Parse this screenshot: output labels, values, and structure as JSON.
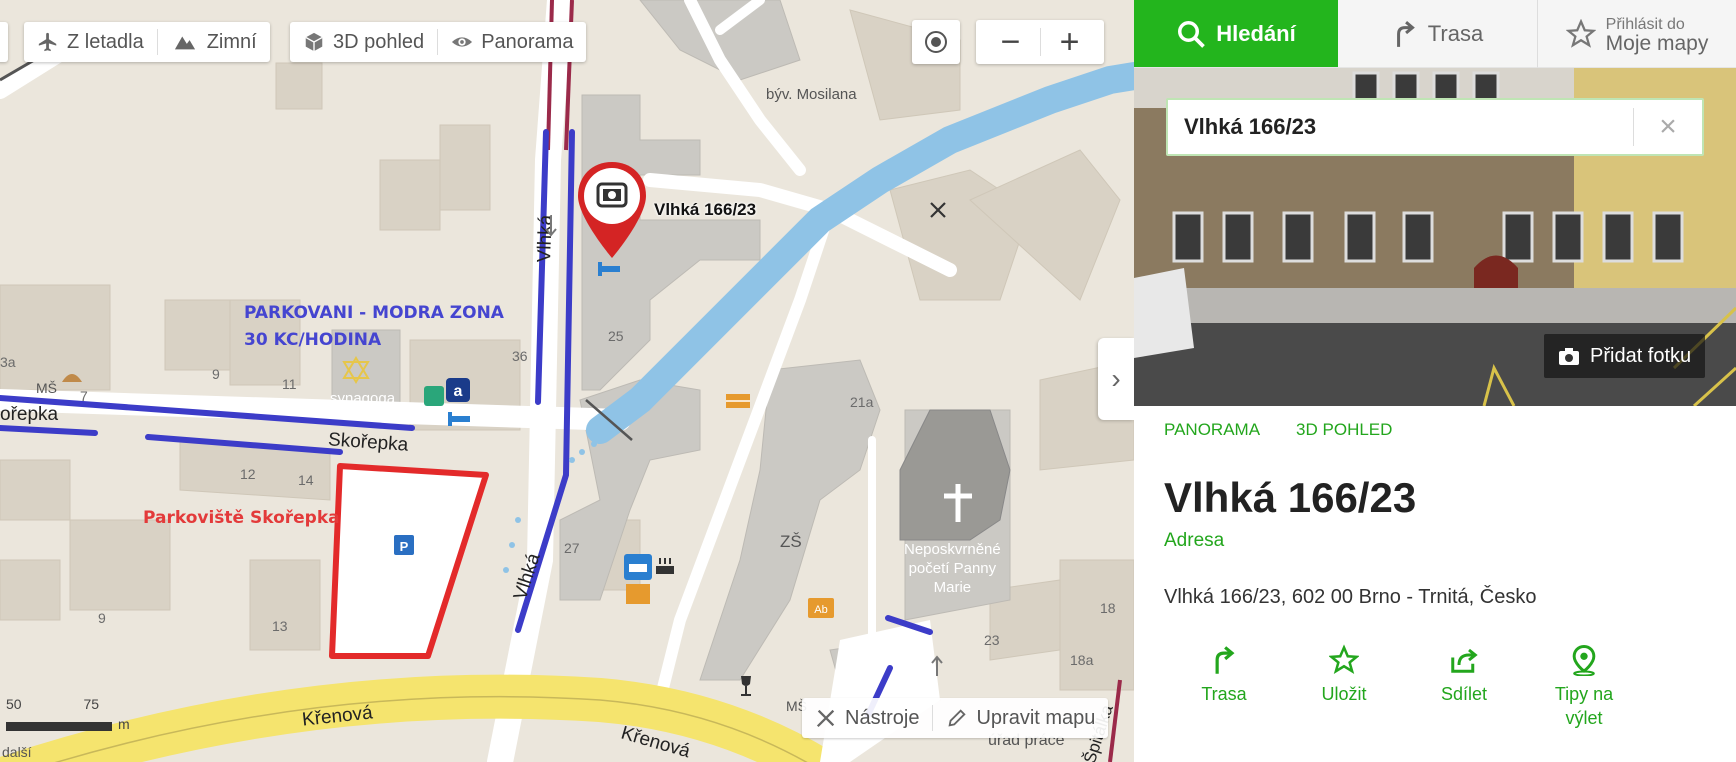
{
  "map": {
    "toolbar": {
      "aerial": "Z letadla",
      "winter": "Zimní",
      "view3d": "3D pohled",
      "panorama": "Panorama"
    },
    "zoom_out": "−",
    "zoom_in": "+",
    "bottom": {
      "tools": "Nástroje",
      "edit": "Upravit mapu"
    },
    "scale": {
      "a": "50",
      "b": "75",
      "unit": "m"
    },
    "more": "další",
    "streets": {
      "skorepka": "Skořepka",
      "skorepka_left": "ořepka",
      "vlhka_top": "Vlhká",
      "vlhka_bottom": "Vlhká",
      "krenova_left": "Křenová",
      "krenova_right": "Křenová",
      "spitalka": "Špitálka"
    },
    "places": {
      "mosilana": "býv. Mosilana",
      "synagoga": "synagoga",
      "church": "Neposkvrněné\npočetí Panny\nMarie",
      "zs": "ZŠ",
      "ms_left": "MŠ",
      "ms_right": "MŠ",
      "urad": "úřad práce",
      "pin_label": "Vlhká 166/23"
    },
    "numbers": [
      "3a",
      "7",
      "9",
      "11",
      "36",
      "25",
      "12",
      "14",
      "27",
      "9",
      "13",
      "21a",
      "18",
      "23",
      "18a"
    ],
    "annotations": {
      "blue_zone": "PARKOVANI - MODRA ZONA\n30 KC/HODINA",
      "parking": "Parkoviště Skořepka"
    },
    "colors": {
      "blue_annotation": "#4040d0",
      "red_annotation": "#e32a2a",
      "river": "#8fc3e6",
      "main_road": "#f7e77a"
    }
  },
  "panel": {
    "tabs": {
      "search": "Hledání",
      "route": "Trasa",
      "login_small": "Přihlásit do",
      "login_big": "Moje mapy"
    },
    "search": {
      "value": "Vlhká 166/23"
    },
    "add_photo": "Přidat fotku",
    "links": {
      "panorama": "PANORAMA",
      "view3d": "3D POHLED"
    },
    "title": "Vlhká 166/23",
    "subtitle": "Adresa",
    "address": "Vlhká 166/23, 602 00 Brno - Trnitá, Česko",
    "actions": {
      "route": "Trasa",
      "save": "Uložit",
      "share": "Sdílet",
      "trip": "Tipy na výlet"
    },
    "accent_color": "#23b51d"
  }
}
